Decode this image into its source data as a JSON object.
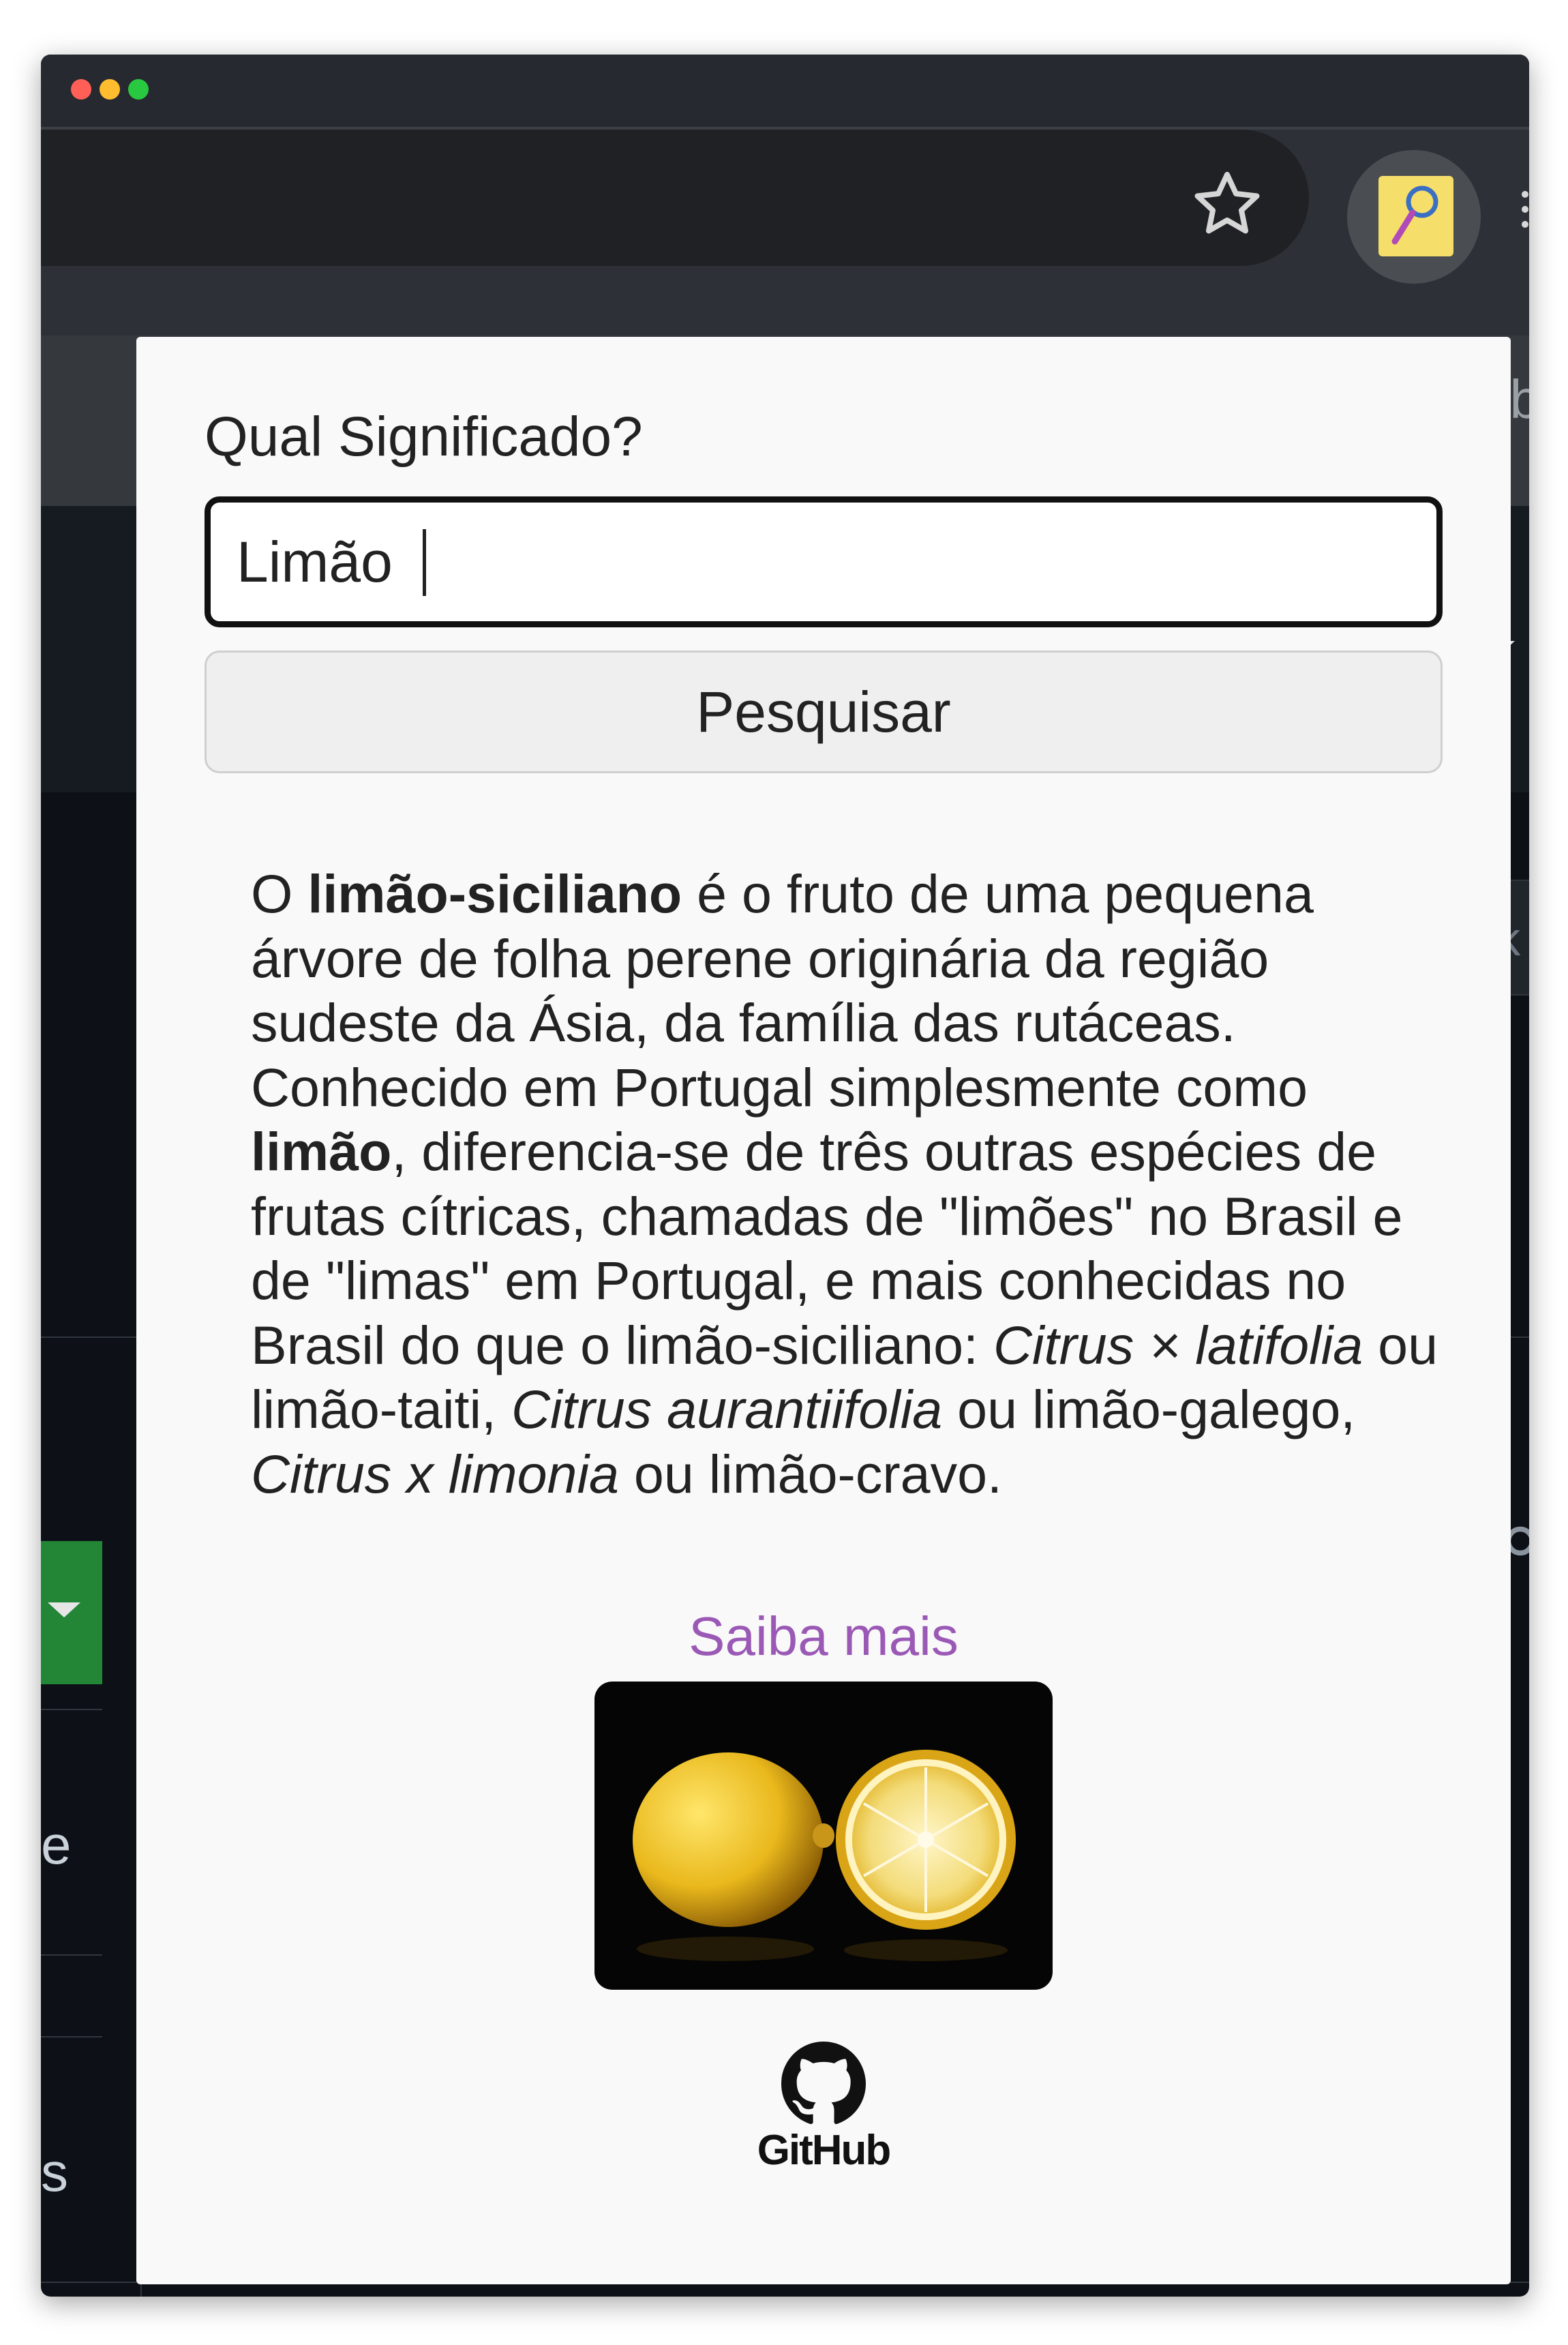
{
  "browser": {
    "bookmark_bar_partial_text": "eb",
    "right_search_partial": "rk",
    "left_edge_texts": [
      "e",
      "s"
    ],
    "right_edge_text": "."
  },
  "popup": {
    "question_label": "Qual Significado?",
    "search_input_value": "Limão",
    "search_button_label": "Pesquisar",
    "description": {
      "parts": [
        {
          "style": "normal",
          "text": "O "
        },
        {
          "style": "bold",
          "text": "limão-siciliano"
        },
        {
          "style": "normal",
          "text": " é o fruto de uma pequena árvore de folha perene originária da região sudeste da Ásia, da família das rutáceas. Conhecido em Portugal simplesmente como "
        },
        {
          "style": "bold",
          "text": "limão"
        },
        {
          "style": "normal",
          "text": ", diferencia-se de três outras espécies de frutas cítricas, chamadas de \"limões\" no Brasil e de \"limas\" em Portugal, e mais conhecidas no Brasil do que o limão-siciliano: "
        },
        {
          "style": "italic",
          "text": "Citrus × latifolia"
        },
        {
          "style": "normal",
          "text": " ou limão-taiti, "
        },
        {
          "style": "italic",
          "text": "Citrus aurantiifolia"
        },
        {
          "style": "normal",
          "text": " ou limão-galego, "
        },
        {
          "style": "italic",
          "text": "Citrus x limonia"
        },
        {
          "style": "normal",
          "text": " ou limão-cravo."
        }
      ]
    },
    "learn_more_link": "Saiba mais",
    "footer_logo_text": "GitHub"
  },
  "colors": {
    "link": "#9b59b6",
    "popup_bg": "#f9f9f9",
    "browser_dark": "#0d1117",
    "primary_green": "#238636"
  },
  "icons": [
    "star-icon",
    "dictionary-extension-icon",
    "more-vert-icon",
    "github-icon"
  ]
}
